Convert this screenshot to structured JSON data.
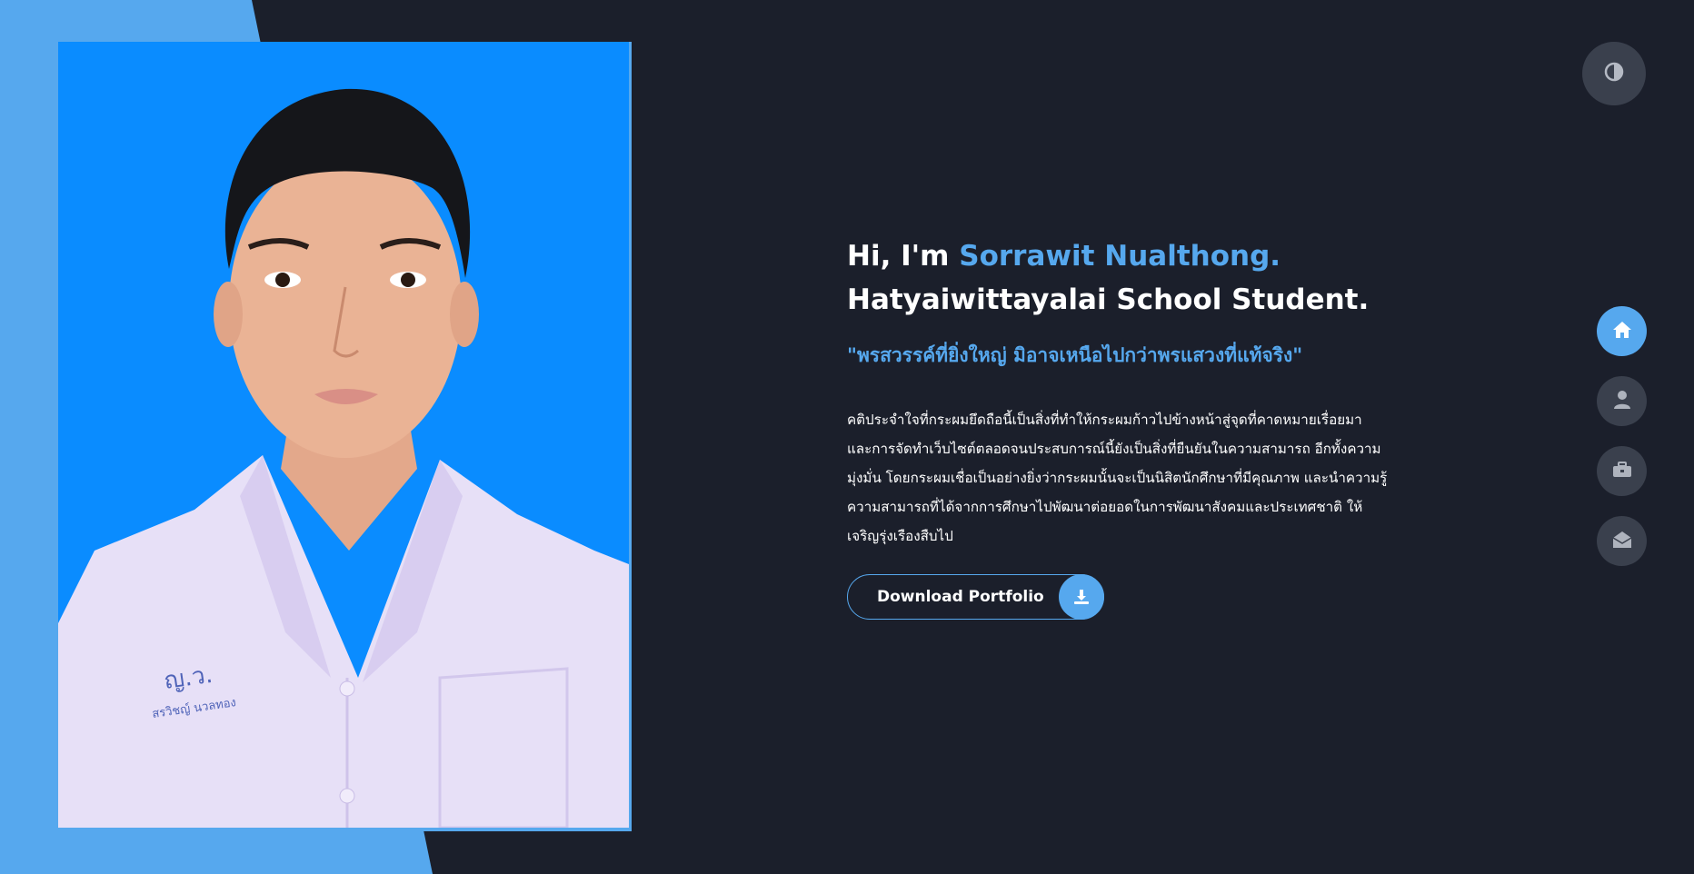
{
  "hero": {
    "greeting_prefix": "Hi, I'm ",
    "name": "Sorrawit Nualthong.",
    "role": "Hatyaiwittayalai School Student.",
    "quote": "\"พรสวรรค์ที่ยิ่งใหญ่ มิอาจเหนือไปกว่าพรแสวงที่แท้จริง\"",
    "description_lines": [
      "คติประจำใจที่กระผมยึดถือนี้เป็นสิ่งที่ทำให้กระผมก้าวไปข้างหน้าสู่จุดที่คาดหมายเรื่อยมา",
      "และการจัดทำเว็บไซต์ตลอดจนประสบการณ์นี้ยังเป็นสิ่งที่ยืนยันในความสามารถ อีกทั้งความ",
      "มุ่งมั่น โดยกระผมเชื่อเป็นอย่างยิ่งว่ากระผมนั้นจะเป็นนิสิตนักศึกษาที่มีคุณภาพ และนำความรู้",
      "ความสามารถที่ได้จากการศึกษาไปพัฒนาต่อยอดในการพัฒนาสังคมและประเทศชาติ ให้",
      "เจริญรุ่งเรืองสืบไป"
    ],
    "download_label": "Download Portfolio"
  },
  "photo": {
    "shirt_embroidery_top": "ญ.ว.",
    "shirt_embroidery_bottom": "สรวิชญ์ นวลทอง"
  },
  "nav": {
    "items": [
      {
        "icon": "home-icon",
        "active": true
      },
      {
        "icon": "user-icon",
        "active": false
      },
      {
        "icon": "briefcase-icon",
        "active": false
      },
      {
        "icon": "envelope-open-icon",
        "active": false
      }
    ]
  },
  "theme_toggle_icon": "contrast-icon",
  "colors": {
    "background": "#1b1f2b",
    "accent": "#56a8ee",
    "photo_background": "#0a8cff",
    "nav_inactive": "#3a404d",
    "text": "#ffffff"
  }
}
